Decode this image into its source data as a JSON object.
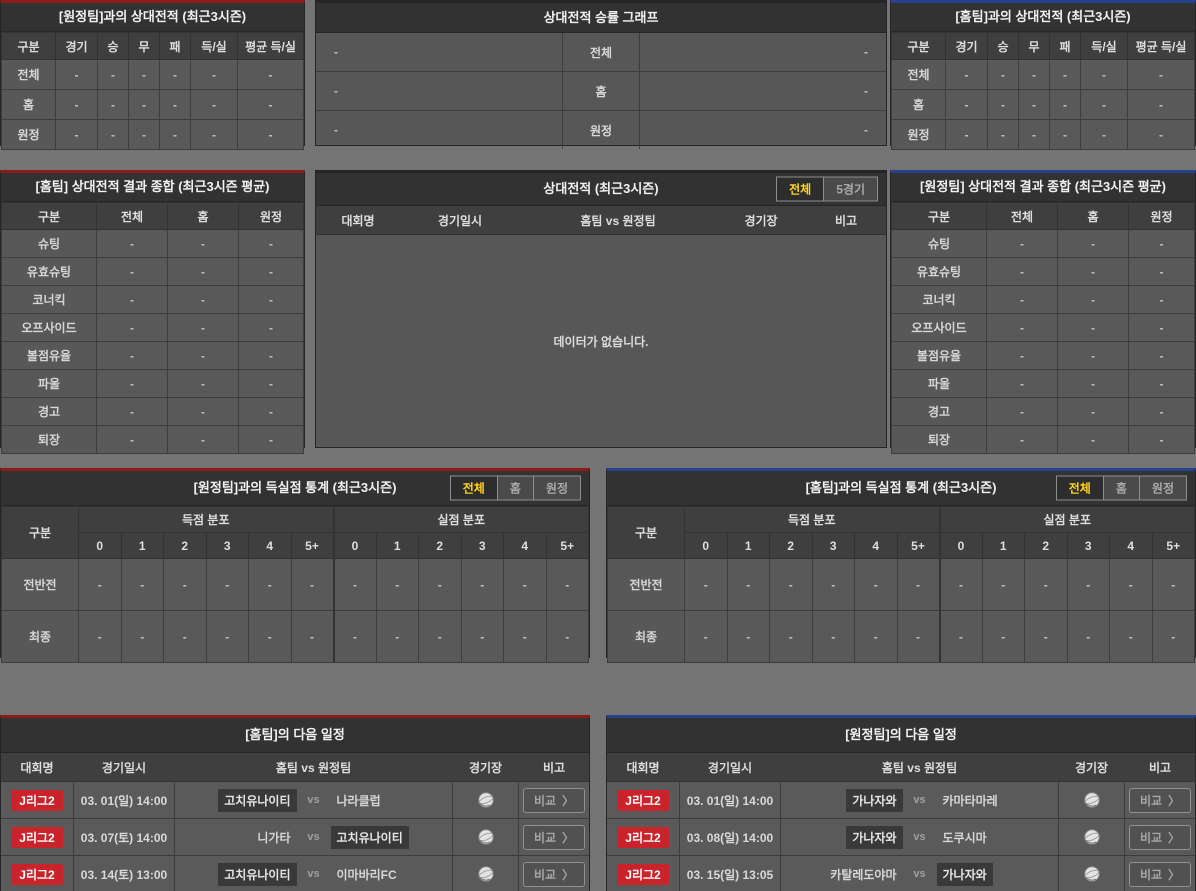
{
  "colors": {
    "accent_red": "#8e1b1b",
    "accent_blue": "#28418c",
    "badge_red": "#c9242c",
    "active_yellow": "#ffd21e"
  },
  "misc": {
    "vs_label": "vs",
    "compare_arrow": "〉"
  },
  "h2h_away": {
    "title": "[원정팀]과의 상대전적 (최근3시즌)",
    "columns": [
      "구분",
      "경기",
      "승",
      "무",
      "패",
      "득/실",
      "평균 득/실"
    ],
    "rows": [
      [
        "전체",
        "-",
        "-",
        "-",
        "-",
        "-",
        "-"
      ],
      [
        "홈",
        "-",
        "-",
        "-",
        "-",
        "-",
        "-"
      ],
      [
        "원정",
        "-",
        "-",
        "-",
        "-",
        "-",
        "-"
      ]
    ]
  },
  "winrate_graph": {
    "title": "상대전적 승률 그래프",
    "rows": [
      {
        "left": "-",
        "label": "전체",
        "right": "-"
      },
      {
        "left": "-",
        "label": "홈",
        "right": "-"
      },
      {
        "left": "-",
        "label": "원정",
        "right": "-"
      }
    ]
  },
  "h2h_home": {
    "title": "[홈팀]과의 상대전적 (최근3시즌)",
    "columns": [
      "구분",
      "경기",
      "승",
      "무",
      "패",
      "득/실",
      "평균 득/실"
    ],
    "rows": [
      [
        "전체",
        "-",
        "-",
        "-",
        "-",
        "-",
        "-"
      ],
      [
        "홈",
        "-",
        "-",
        "-",
        "-",
        "-",
        "-"
      ],
      [
        "원정",
        "-",
        "-",
        "-",
        "-",
        "-",
        "-"
      ]
    ]
  },
  "summary_home": {
    "title": "[홈팀] 상대전적 결과 종합 (최근3시즌 평균)",
    "columns": [
      "구분",
      "전체",
      "홈",
      "원정"
    ],
    "rows": [
      [
        "슈팅",
        "-",
        "-",
        "-"
      ],
      [
        "유효슈팅",
        "-",
        "-",
        "-"
      ],
      [
        "코너킥",
        "-",
        "-",
        "-"
      ],
      [
        "오프사이드",
        "-",
        "-",
        "-"
      ],
      [
        "볼점유율",
        "-",
        "-",
        "-"
      ],
      [
        "파울",
        "-",
        "-",
        "-"
      ],
      [
        "경고",
        "-",
        "-",
        "-"
      ],
      [
        "퇴장",
        "-",
        "-",
        "-"
      ]
    ]
  },
  "h2h_list": {
    "title": "상대전적 (최근3시즌)",
    "toggles": [
      "전체",
      "5경기"
    ],
    "columns": [
      "대회명",
      "경기일시",
      "홈팀  vs  원정팀",
      "경기장",
      "비고"
    ],
    "empty_message": "데이터가 없습니다."
  },
  "summary_away": {
    "title": "[원정팀] 상대전적 결과 종합 (최근3시즌 평균)",
    "columns": [
      "구분",
      "전체",
      "홈",
      "원정"
    ],
    "rows": [
      [
        "슈팅",
        "-",
        "-",
        "-"
      ],
      [
        "유효슈팅",
        "-",
        "-",
        "-"
      ],
      [
        "코너킥",
        "-",
        "-",
        "-"
      ],
      [
        "오프사이드",
        "-",
        "-",
        "-"
      ],
      [
        "볼점유율",
        "-",
        "-",
        "-"
      ],
      [
        "파울",
        "-",
        "-",
        "-"
      ],
      [
        "경고",
        "-",
        "-",
        "-"
      ],
      [
        "퇴장",
        "-",
        "-",
        "-"
      ]
    ]
  },
  "goals_away": {
    "title": "[원정팀]과의 득실점 통계 (최근3시즌)",
    "toggles": [
      "전체",
      "홈",
      "원정"
    ],
    "corner_label": "구분",
    "groups": [
      "득점 분포",
      "실점 분포"
    ],
    "bins": [
      "0",
      "1",
      "2",
      "3",
      "4",
      "5+"
    ],
    "rows": [
      [
        "전반전",
        "-",
        "-",
        "-",
        "-",
        "-",
        "-",
        "-",
        "-",
        "-",
        "-",
        "-",
        "-"
      ],
      [
        "최종",
        "-",
        "-",
        "-",
        "-",
        "-",
        "-",
        "-",
        "-",
        "-",
        "-",
        "-",
        "-"
      ]
    ]
  },
  "goals_home": {
    "title": "[홈팀]과의 득실점 통계 (최근3시즌)",
    "toggles": [
      "전체",
      "홈",
      "원정"
    ],
    "corner_label": "구분",
    "groups": [
      "득점 분포",
      "실점 분포"
    ],
    "bins": [
      "0",
      "1",
      "2",
      "3",
      "4",
      "5+"
    ],
    "rows": [
      [
        "전반전",
        "-",
        "-",
        "-",
        "-",
        "-",
        "-",
        "-",
        "-",
        "-",
        "-",
        "-",
        "-"
      ],
      [
        "최종",
        "-",
        "-",
        "-",
        "-",
        "-",
        "-",
        "-",
        "-",
        "-",
        "-",
        "-",
        "-"
      ]
    ]
  },
  "schedule_home": {
    "title": "[홈팀]의 다음 일정",
    "columns": [
      "대회명",
      "경기일시",
      "홈팀  vs  원정팀",
      "경기장",
      "비고"
    ],
    "compare_label": "비교",
    "rows": [
      {
        "league": "J리그2",
        "datetime": "03. 01(일) 14:00",
        "home": "고치유나이티",
        "away": "나라클럽",
        "highlight": "home"
      },
      {
        "league": "J리그2",
        "datetime": "03. 07(토) 14:00",
        "home": "니가타",
        "away": "고치유나이티",
        "highlight": "away"
      },
      {
        "league": "J리그2",
        "datetime": "03. 14(토) 13:00",
        "home": "고치유나이티",
        "away": "이마바리FC",
        "highlight": "home"
      }
    ]
  },
  "schedule_away": {
    "title": "[원정팀]의 다음 일정",
    "columns": [
      "대회명",
      "경기일시",
      "홈팀  vs  원정팀",
      "경기장",
      "비고"
    ],
    "compare_label": "비교",
    "rows": [
      {
        "league": "J리그2",
        "datetime": "03. 01(일) 14:00",
        "home": "가나자와",
        "away": "카마타마레",
        "highlight": "home"
      },
      {
        "league": "J리그2",
        "datetime": "03. 08(일) 14:00",
        "home": "가나자와",
        "away": "도쿠시마",
        "highlight": "home"
      },
      {
        "league": "J리그2",
        "datetime": "03. 15(일) 13:05",
        "home": "카탈레도야마",
        "away": "가나자와",
        "highlight": "away"
      }
    ]
  }
}
